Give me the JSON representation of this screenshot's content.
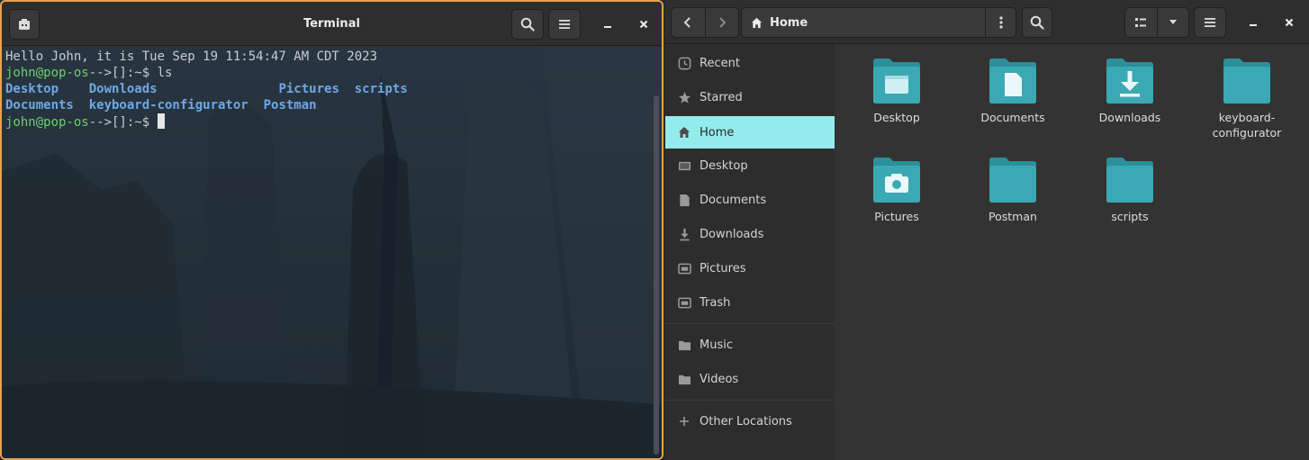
{
  "terminal": {
    "title": "Terminal",
    "icons": {
      "new_tab": "new-tab-icon",
      "search": "search-icon",
      "menu": "hamburger-menu-icon",
      "minimize": "minimize-icon",
      "close": "close-icon"
    },
    "lines": [
      {
        "text": "Hello John, it is Tue Sep 19 11:54:47 AM CDT 2023"
      },
      {
        "prompt": "john@pop-os",
        "rest": "-->[]:~$ ls"
      },
      {
        "cols": [
          "Desktop",
          "Downloads",
          "Pictures",
          "scripts"
        ]
      },
      {
        "cols": [
          "Documents",
          "keyboard-configurator",
          "Postman"
        ]
      },
      {
        "prompt": "john@pop-os",
        "rest": "-->[]:~$ "
      }
    ]
  },
  "files": {
    "location": "Home",
    "icons": {
      "back": "chevron-left-icon",
      "forward": "chevron-right-icon",
      "home": "home-icon",
      "path_menu": "kebab-menu-icon",
      "search": "search-icon",
      "view_list": "list-view-icon",
      "view_options": "chevron-down-icon",
      "menu": "hamburger-menu-icon",
      "minimize": "minimize-icon",
      "close": "close-icon"
    },
    "sidebar": [
      {
        "label": "Recent",
        "icon": "clock-icon"
      },
      {
        "label": "Starred",
        "icon": "star-icon"
      },
      {
        "label": "Home",
        "icon": "home-icon",
        "active": true
      },
      {
        "label": "Desktop",
        "icon": "desktop-icon"
      },
      {
        "label": "Documents",
        "icon": "document-icon"
      },
      {
        "label": "Downloads",
        "icon": "download-icon"
      },
      {
        "label": "Pictures",
        "icon": "picture-icon"
      },
      {
        "label": "Trash",
        "icon": "trash-icon"
      },
      {
        "label": "Music",
        "icon": "folder-icon"
      },
      {
        "label": "Videos",
        "icon": "folder-icon"
      },
      {
        "label": "Other Locations",
        "icon": "plus-icon"
      }
    ],
    "items": [
      {
        "name": "Desktop",
        "icon": "desktop-folder-icon"
      },
      {
        "name": "Documents",
        "icon": "documents-folder-icon"
      },
      {
        "name": "Downloads",
        "icon": "downloads-folder-icon"
      },
      {
        "name": "keyboard-configurator",
        "icon": "folder-icon"
      },
      {
        "name": "Pictures",
        "icon": "pictures-folder-icon"
      },
      {
        "name": "Postman",
        "icon": "folder-icon"
      },
      {
        "name": "scripts",
        "icon": "folder-icon"
      }
    ]
  },
  "colors": {
    "terminal_border": "#e8a250",
    "sidebar_active": "#94ebeb",
    "folder": "#3aa9b4",
    "prompt": "#6dcf6d",
    "directory": "#6ea8e8"
  }
}
